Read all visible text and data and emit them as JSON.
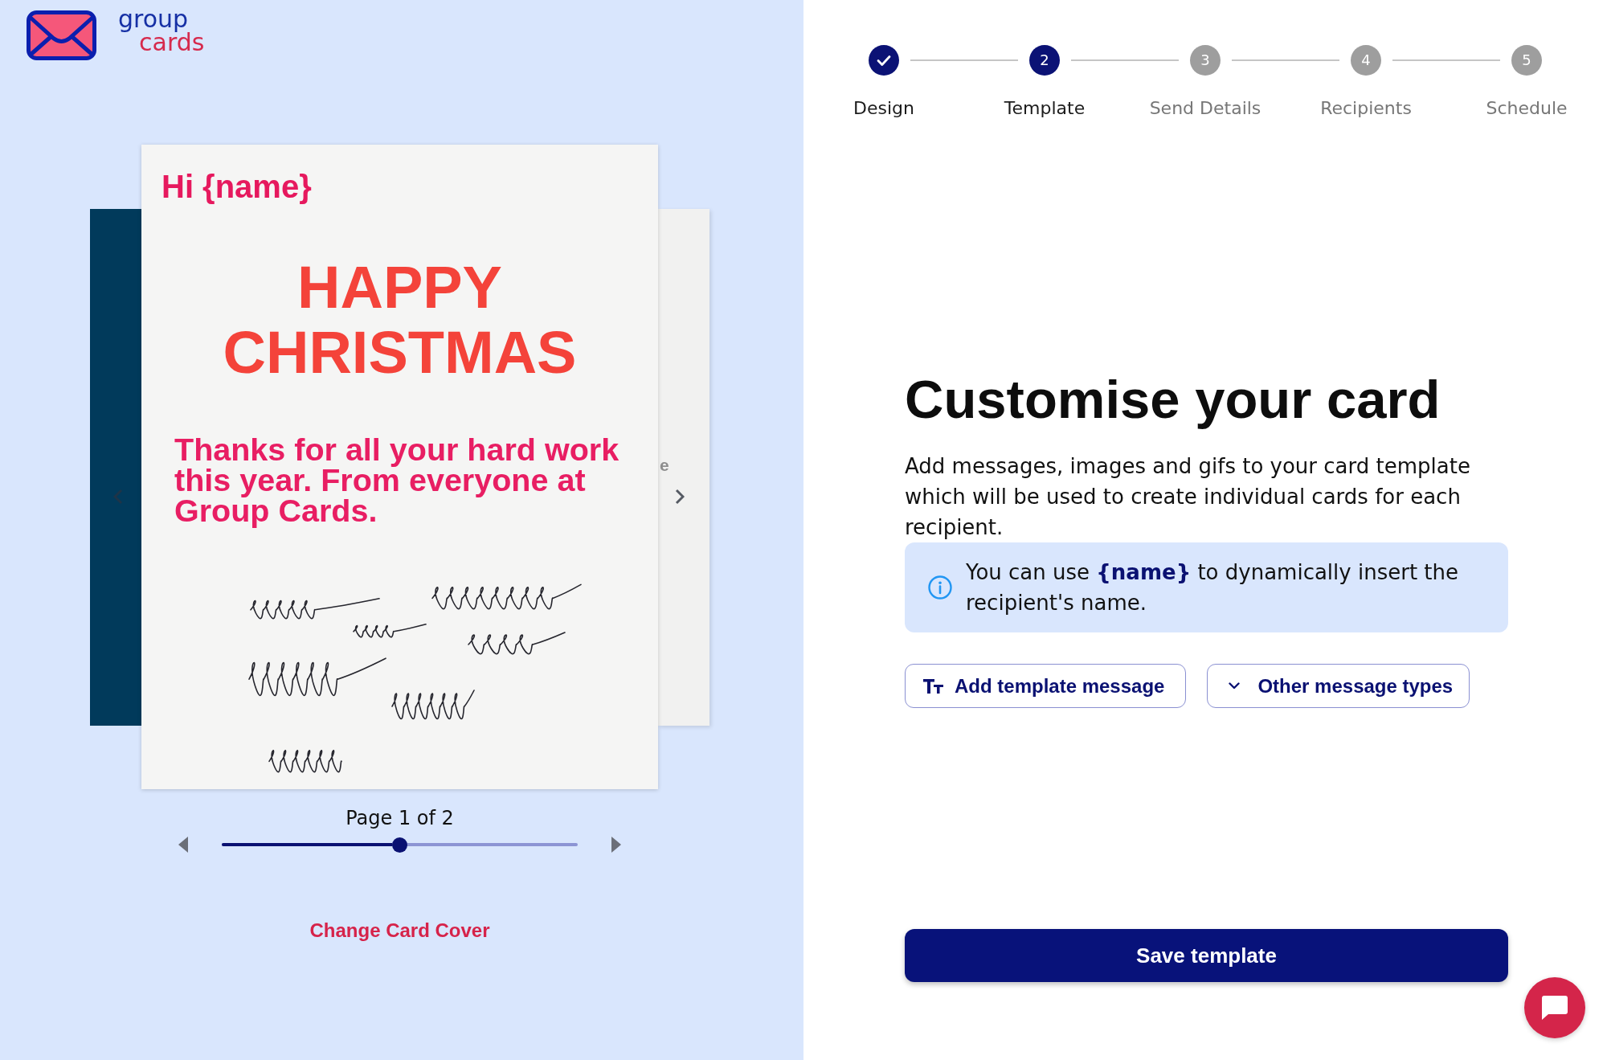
{
  "logo": {
    "top": "group",
    "bottom": "cards"
  },
  "card_preview": {
    "back_page_text": "e",
    "greeting": "Hi {name}",
    "title": "HAPPY CHRISTMAS",
    "message": "Thanks for all your hard work this year. From everyone at Group Cards."
  },
  "page_nav": {
    "label": "Page 1 of 2",
    "level": 0.5
  },
  "change_cover_link": "Change Card Cover",
  "steps": [
    {
      "label": "Design",
      "completed": true,
      "current": false
    },
    {
      "number": "2",
      "label": "Template",
      "completed": false,
      "current": true
    },
    {
      "number": "3",
      "label": "Send Details",
      "completed": false,
      "current": false
    },
    {
      "number": "4",
      "label": "Recipients",
      "completed": false,
      "current": false
    },
    {
      "number": "5",
      "label": "Schedule",
      "completed": false,
      "current": false
    }
  ],
  "heading": "Customise your card",
  "description": "Add messages, images and gifs to your card template which will be used to create individual cards for each recipient.",
  "info_note": "You can use **{name}** to dynamically insert the recipient's name.",
  "actions": [
    {
      "kind": "text",
      "label": "Add template message"
    },
    {
      "kind": "dropdown",
      "label": "Other message types"
    }
  ],
  "save_button": "Save template"
}
